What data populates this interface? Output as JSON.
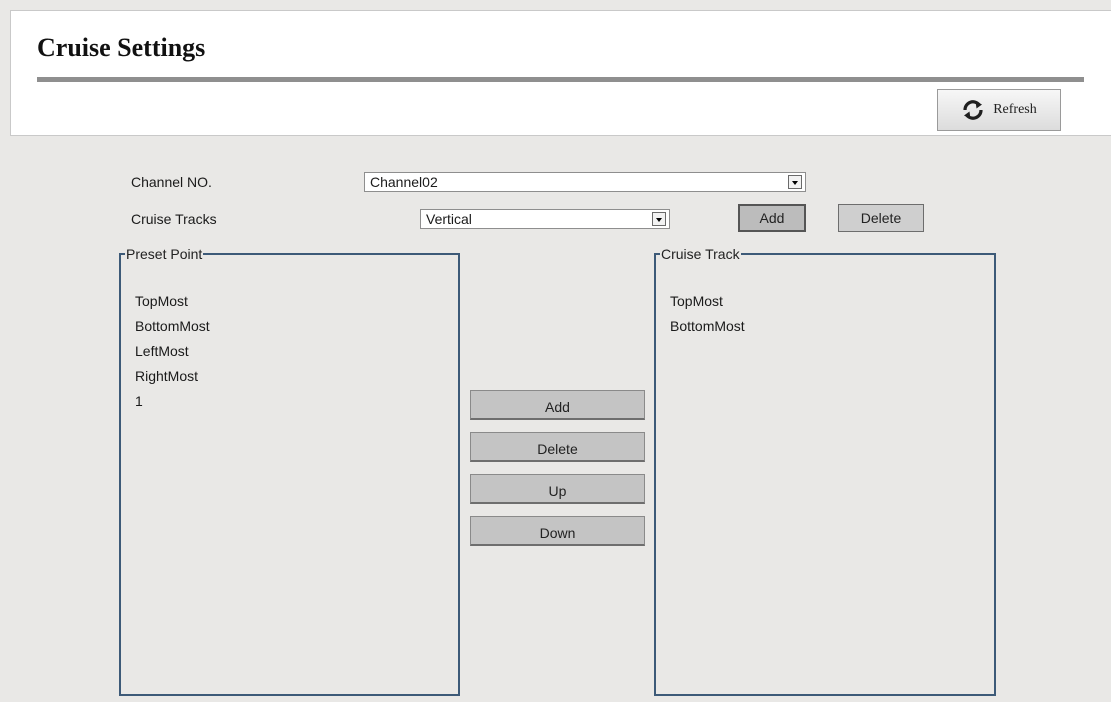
{
  "header": {
    "title": "Cruise Settings",
    "refresh_label": "Refresh"
  },
  "form": {
    "channel_label": "Channel NO.",
    "channel_value": "Channel02",
    "tracks_label": "Cruise Tracks",
    "tracks_value": "Vertical",
    "add_label": "Add",
    "delete_label": "Delete"
  },
  "preset": {
    "legend": "Preset Point",
    "items": [
      "TopMost",
      "BottomMost",
      "LeftMost",
      "RightMost",
      "1"
    ]
  },
  "controls": {
    "add": "Add",
    "delete": "Delete",
    "up": "Up",
    "down": "Down"
  },
  "cruise": {
    "legend": "Cruise Track",
    "items": [
      "TopMost",
      "BottomMost"
    ]
  },
  "colors": {
    "background": "#e9e8e6",
    "group_border": "#3d5a78",
    "button_gray": "#c4c4c4"
  },
  "icons": {
    "refresh": "refresh-icon",
    "dropdown": "dropdown-arrow-icon"
  }
}
